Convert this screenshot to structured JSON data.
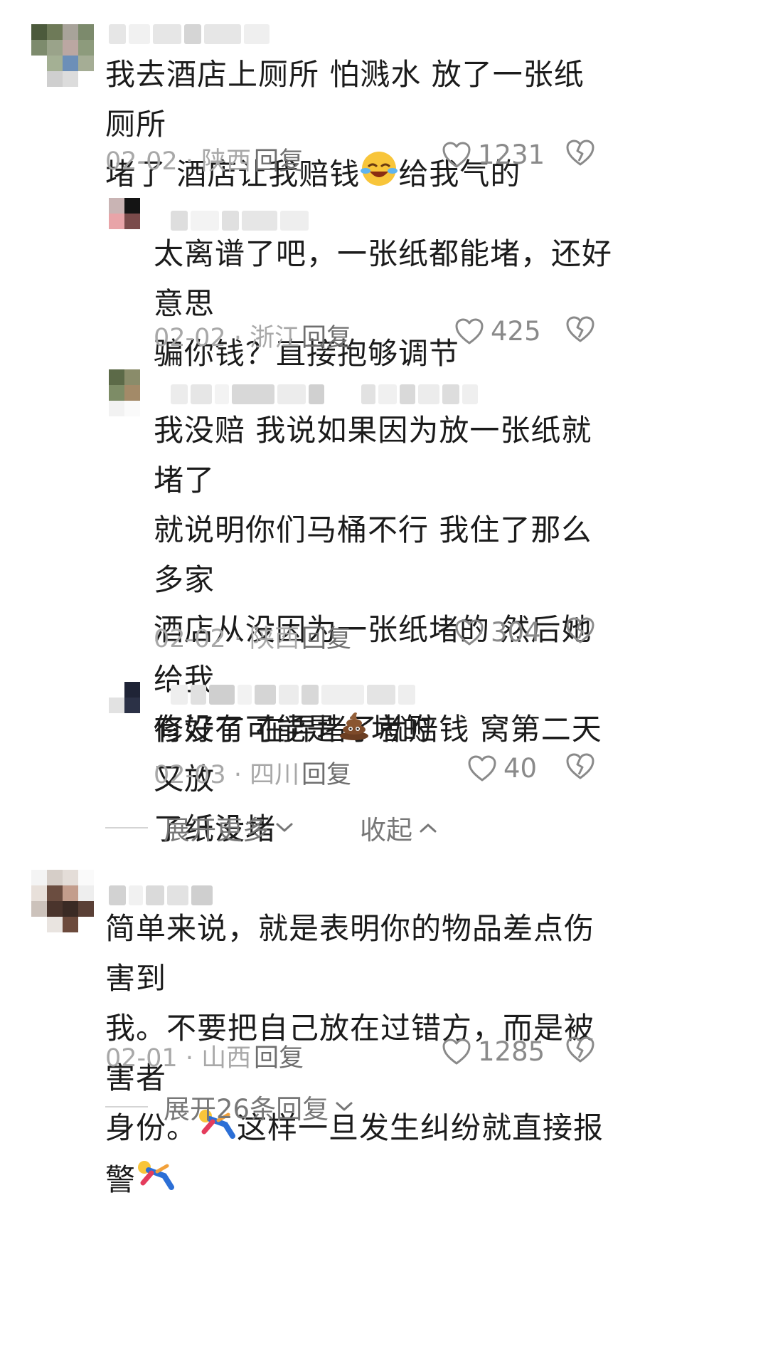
{
  "comments": [
    {
      "text_lines": [
        "我去酒店上厕所 怕溅水 放了一张纸 厕所",
        "堵了 酒店让我赔钱",
        "给我气的"
      ],
      "emoji": "laughing-crying-face",
      "date": "02-02 · 陕西",
      "reply": "回复",
      "likes": "1231"
    },
    {
      "text_lines": [
        "太离谱了吧，一张纸都能堵，还好意思",
        "骗你钱？直接抱够调节"
      ],
      "date": "02-02 · 浙江",
      "reply": "回复",
      "likes": "425"
    },
    {
      "text_lines": [
        "我没赔 我说如果因为放一张纸就堵了",
        "就说明你们马桶不行  我住了那么多家",
        "酒店从没因为一张纸堵的 然后她给我",
        "修好了 在弄堵了就赔钱 窝第二天又放",
        "了纸没堵"
      ],
      "date": "02-02 · 陕西",
      "reply": "回复",
      "likes": "304"
    },
    {
      "text_prefix": "有没有可能是",
      "emoji": "poop",
      "text_suffix": "堵的",
      "date": "02-03 · 四川",
      "reply": "回复",
      "likes": "40"
    },
    {
      "text_lines": [
        "简单来说，就是表明你的物品差点伤害到",
        "我。不要把自己放在过错方，而是被害者",
        "身份。",
        "这样一旦发生纠纷就直接报警"
      ],
      "emoji": "person-falling",
      "date": "02-01 · 山西",
      "reply": "回复",
      "likes": "1285"
    }
  ],
  "controls": {
    "expand_more": "展开更多",
    "collapse": "收起",
    "expand_replies": "展开26条回复"
  },
  "colors": {
    "text": "#1b1b1b",
    "meta": "#a8a8a8",
    "icon": "#8a8a8a"
  }
}
